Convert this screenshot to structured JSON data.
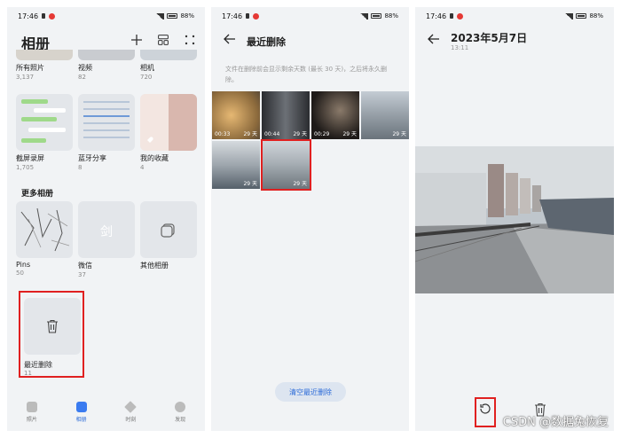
{
  "status": {
    "time": "17:46",
    "battery": "88%"
  },
  "panel1": {
    "title": "相册",
    "top_albums": [
      {
        "name": "所有照片",
        "count": "3,137"
      },
      {
        "name": "视频",
        "count": "82"
      },
      {
        "name": "相机",
        "count": "720"
      }
    ],
    "row2_albums": [
      {
        "name": "截屏录屏",
        "count": "1,705"
      },
      {
        "name": "蓝牙分享",
        "count": "8"
      },
      {
        "name": "我的收藏",
        "count": "4"
      }
    ],
    "section_title": "更多相册",
    "more_albums": [
      {
        "name": "Pins",
        "count": "50"
      },
      {
        "name": "微信",
        "count": "37"
      },
      {
        "name": "其他相册",
        "count": ""
      }
    ],
    "wechat_thumb_text": "剑",
    "deleted_album": {
      "name": "最近删除",
      "count": "11"
    },
    "nav": [
      {
        "label": "照片",
        "icon": "photos-icon"
      },
      {
        "label": "相册",
        "icon": "albums-icon"
      },
      {
        "label": "时刻",
        "icon": "moments-icon"
      },
      {
        "label": "发现",
        "icon": "discover-icon"
      }
    ]
  },
  "panel2": {
    "title": "最近删除",
    "note": "文件在删除前会显示剩余天数 (最长 30 天)，之后将永久删除。",
    "items": [
      {
        "duration": "00:33",
        "days": "29 天",
        "color": "#c9a56a"
      },
      {
        "duration": "00:44",
        "days": "29 天",
        "color": "#3a3c40"
      },
      {
        "duration": "00:29",
        "days": "29 天",
        "color": "#2a2522"
      },
      {
        "duration": "",
        "days": "29 天",
        "color": "#8a96a3"
      },
      {
        "duration": "",
        "days": "29 天",
        "color": "#5d6a73"
      },
      {
        "duration": "",
        "days": "29 天",
        "color": "#7a8690"
      }
    ],
    "clear_label": "清空最近删除"
  },
  "panel3": {
    "title": "2023年5月7日",
    "time": "13:11"
  },
  "watermark": "CSDN @数据兔恢复",
  "colors": {
    "accent": "#2b6bd8",
    "highlight": "#e02020"
  }
}
